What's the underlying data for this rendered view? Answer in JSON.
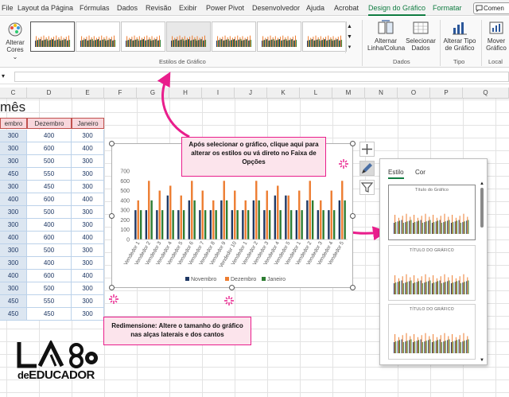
{
  "tabs": [
    {
      "label": "File",
      "x": 2
    },
    {
      "label": "Layout da Página",
      "x": 22
    },
    {
      "label": "Fórmulas",
      "x": 100
    },
    {
      "label": "Dados",
      "x": 147
    },
    {
      "label": "Revisão",
      "x": 183
    },
    {
      "label": "Exibir",
      "x": 225
    },
    {
      "label": "Power Pivot",
      "x": 259
    },
    {
      "label": "Desenvolvedor",
      "x": 317
    },
    {
      "label": "Ajuda",
      "x": 385
    },
    {
      "label": "Acrobat",
      "x": 420
    },
    {
      "label": "Design do Gráfico",
      "x": 463
    },
    {
      "label": "Formatar",
      "x": 544
    }
  ],
  "comment_label": "Comen",
  "ribbon": {
    "change_colors": "Alterar Cores",
    "chart_styles_group": "Estilos de Gráfico",
    "switch_row_col": "Alternar Linha/Coluna",
    "select_data": "Selecionar Dados",
    "data_group": "Dados",
    "change_type": "Alterar Tipo de Gráfico",
    "type_group": "Tipo",
    "move_chart": "Mover Gráfico",
    "location_group": "Local"
  },
  "formula_bar": {
    "value": ""
  },
  "columns": [
    "C",
    "D",
    "E",
    "F",
    "G",
    "H",
    "I",
    "J",
    "K",
    "L",
    "M",
    "N",
    "O",
    "P",
    "Q"
  ],
  "sheet": {
    "title": "mês",
    "headers": [
      "embro",
      "Dezembro",
      "Janeiro"
    ],
    "rows": [
      [
        "300",
        "400",
        "300"
      ],
      [
        "300",
        "600",
        "400"
      ],
      [
        "300",
        "500",
        "300"
      ],
      [
        "450",
        "550",
        "300"
      ],
      [
        "300",
        "450",
        "300"
      ],
      [
        "400",
        "600",
        "400"
      ],
      [
        "300",
        "500",
        "300"
      ],
      [
        "300",
        "400",
        "300"
      ],
      [
        "400",
        "600",
        "400"
      ],
      [
        "300",
        "500",
        "300"
      ],
      [
        "300",
        "400",
        "300"
      ],
      [
        "400",
        "600",
        "400"
      ],
      [
        "300",
        "500",
        "300"
      ],
      [
        "450",
        "550",
        "300"
      ],
      [
        "450",
        "450",
        "300"
      ]
    ]
  },
  "chart_data": {
    "type": "bar",
    "title": "",
    "xlabel": "",
    "ylabel": "",
    "ylim": [
      0,
      700
    ],
    "yticks": [
      0,
      100,
      200,
      300,
      400,
      500,
      600,
      700
    ],
    "categories": [
      "Vendedor 1",
      "Vendedor 2",
      "Vendedor 3",
      "Vendedor 4",
      "Vendedor 5",
      "Vendedor 6",
      "Vendedor 7",
      "Vendedor 8",
      "Vendedor 9",
      "Vendedor 10",
      "Vendedor 1",
      "Vendedor 2",
      "Vendedor 3",
      "Vendedor 4",
      "Vendedor 5",
      "Vendedor 1",
      "Vendedor 2",
      "Vendedor 3",
      "Vendedor 4",
      "Vendedor 5"
    ],
    "series": [
      {
        "name": "Novembro",
        "color": "#1f3864",
        "values": [
          300,
          300,
          300,
          450,
          300,
          400,
          300,
          300,
          400,
          300,
          300,
          400,
          300,
          450,
          450,
          300,
          400,
          300,
          300,
          400
        ]
      },
      {
        "name": "Dezembro",
        "color": "#ed7d31",
        "values": [
          400,
          600,
          500,
          550,
          450,
          600,
          500,
          400,
          600,
          500,
          400,
          600,
          500,
          550,
          450,
          500,
          600,
          400,
          500,
          600
        ]
      },
      {
        "name": "Janeiro",
        "color": "#2e7d32",
        "values": [
          300,
          400,
          300,
          300,
          300,
          400,
          300,
          300,
          400,
          300,
          300,
          400,
          300,
          300,
          300,
          300,
          400,
          300,
          300,
          400
        ]
      }
    ],
    "legend": "bottom",
    "grid": false
  },
  "pane": {
    "tab_style": "Estilo",
    "tab_color": "Cor",
    "thumb_titles": [
      "Título do Gráfico",
      "TÍTULO DO GRÁFICO",
      "TÍTULO DO GRÁFICO"
    ]
  },
  "callouts": {
    "styles": "Após selecionar o gráfico, clique aqui para alterar os estilos ou vá direto no Faixa de Opções",
    "resize": "Redimensione: Altere o tamanho do gráfico nas alças laterais e dos cantos"
  },
  "logo": {
    "line1": "de",
    "line2": "EDUCADOR"
  },
  "colors": {
    "accent": "#107c41",
    "callout": "#e91e8c",
    "callout_bg": "#fce4ec"
  }
}
